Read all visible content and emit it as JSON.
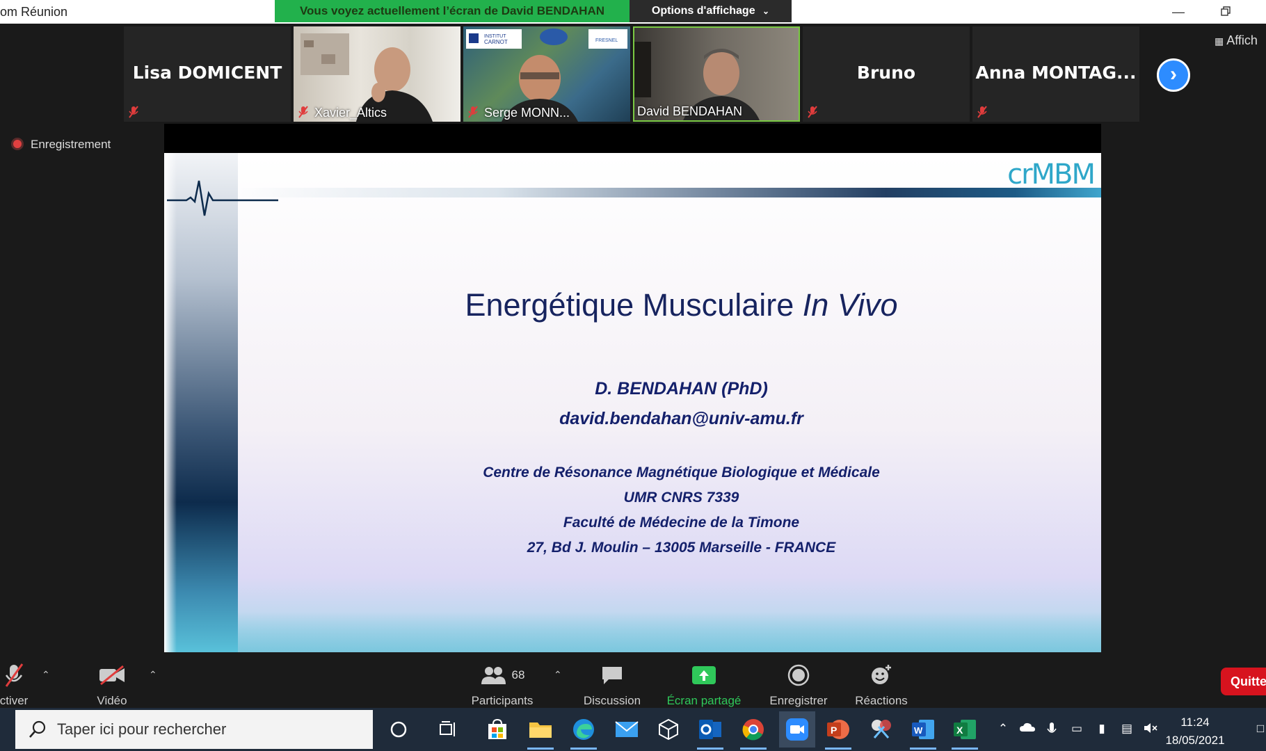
{
  "titlebar": {
    "app_title": "om Réunion",
    "share_banner": "Vous voyez actuellement l’écran de David BENDAHAN",
    "view_options": "Options d'affichage"
  },
  "gallery": {
    "participants": [
      {
        "name": "Lisa DOMICENT",
        "video": false,
        "muted": true
      },
      {
        "name": "Xavier_Altics",
        "video": true,
        "muted": true
      },
      {
        "name": "Serge MONN...",
        "video": true,
        "muted": true
      },
      {
        "name": "David BENDAHAN",
        "video": true,
        "muted": false,
        "active": true
      },
      {
        "name": "Bruno",
        "video": false,
        "muted": true
      },
      {
        "name": "Anna  MONTAG...",
        "video": false,
        "muted": true
      }
    ],
    "view_label": "Affich"
  },
  "recording": {
    "label": "Enregistrement"
  },
  "slide": {
    "title_main": "Energétique Musculaire ",
    "title_italic": "In Vivo",
    "author": "D. BENDAHAN (PhD)",
    "email": "david.bendahan@univ-amu.fr",
    "lab_lines": [
      "Centre de Résonance Magnétique Biologique et Médicale",
      "UMR CNRS 7339",
      "Faculté de Médecine de la Timone",
      "27, Bd J. Moulin – 13005 Marseille - FRANCE"
    ],
    "logo": "crMBM"
  },
  "controls": {
    "mic_label": "ctiver",
    "video_label": "Vidéo",
    "participants_count": "68",
    "participants_label": "Participants",
    "chat_label": "Discussion",
    "share_label": "Écran partagé",
    "record_label": "Enregistrer",
    "reactions_label": "Réactions",
    "quit_label": "Quitte"
  },
  "taskbar": {
    "search_placeholder": "Taper ici pour rechercher",
    "time": "11:24",
    "date": "18/05/2021"
  },
  "colors": {
    "share_green": "#22b14c",
    "zoom_blue": "#2d8cff",
    "quit_red": "#d7131e",
    "slide_text": "#14206b"
  }
}
